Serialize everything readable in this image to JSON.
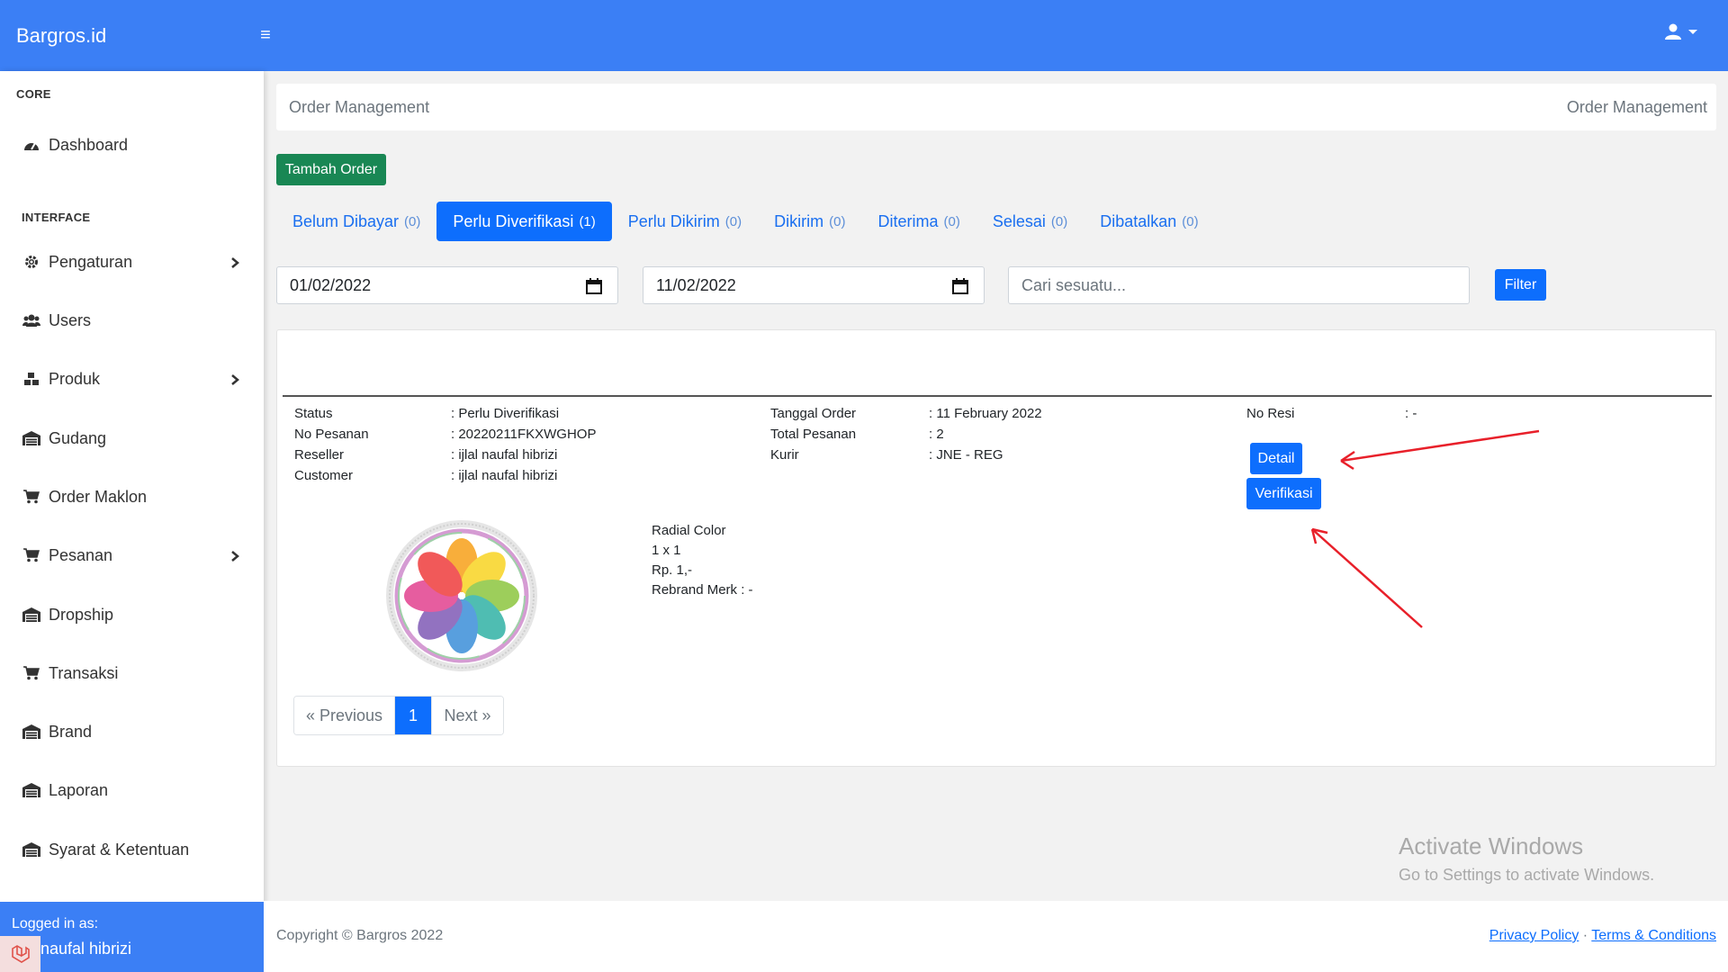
{
  "app": {
    "brand": "Bargros.id",
    "menu_icon": "hamburger-icon",
    "user_icon": "user-icon"
  },
  "sidebar": {
    "heading_core": "CORE",
    "heading_interface": "INTERFACE",
    "items": [
      {
        "label": "Dashboard",
        "icon": "tachometer-icon"
      },
      {
        "label": "Pengaturan",
        "icon": "gear-icon",
        "has_submenu": true
      },
      {
        "label": "Users",
        "icon": "users-icon"
      },
      {
        "label": "Produk",
        "icon": "boxes-icon",
        "has_submenu": true
      },
      {
        "label": "Gudang",
        "icon": "warehouse-icon"
      },
      {
        "label": "Order Maklon",
        "icon": "cart-icon"
      },
      {
        "label": "Pesanan",
        "icon": "cart-icon",
        "has_submenu": true
      },
      {
        "label": "Dropship",
        "icon": "warehouse-icon"
      },
      {
        "label": "Transaksi",
        "icon": "cart-icon"
      },
      {
        "label": "Brand",
        "icon": "warehouse-icon"
      },
      {
        "label": "Laporan",
        "icon": "warehouse-icon"
      },
      {
        "label": "Syarat & Ketentuan",
        "icon": "warehouse-icon"
      }
    ],
    "footer": {
      "label": "Logged in as:",
      "user": "naufal hibrizi"
    }
  },
  "header": {
    "title": "Order Management",
    "breadcrumb": "Order Management"
  },
  "actions": {
    "add_order": "Tambah Order"
  },
  "tabs": [
    {
      "label": "Belum Dibayar",
      "count": "(0)"
    },
    {
      "label": "Perlu Diverifikasi",
      "count": "(1)",
      "active": true
    },
    {
      "label": "Perlu Dikirim",
      "count": "(0)"
    },
    {
      "label": "Dikirim",
      "count": "(0)"
    },
    {
      "label": "Diterima",
      "count": "(0)"
    },
    {
      "label": "Selesai",
      "count": "(0)"
    },
    {
      "label": "Dibatalkan",
      "count": "(0)"
    }
  ],
  "filters": {
    "date_from": "01/02/2022",
    "date_to": "11/02/2022",
    "search_placeholder": "Cari sesuatu...",
    "filter_button": "Filter"
  },
  "order": {
    "status_label": "Status",
    "status_value": ": Perlu Diverifikasi",
    "no_pesanan_label": "No Pesanan",
    "no_pesanan_value": ": 20220211FKXWGHOP",
    "reseller_label": "Reseller",
    "reseller_value": ": ijlal naufal hibrizi",
    "customer_label": "Customer",
    "customer_value": ": ijlal naufal hibrizi",
    "tanggal_label": "Tanggal Order",
    "tanggal_value": ": 11 February 2022",
    "total_label": "Total Pesanan",
    "total_value": ": 2",
    "kurir_label": "Kurir",
    "kurir_value": ": JNE - REG",
    "resi_label": "No Resi",
    "resi_value": ": -",
    "detail_button": "Detail",
    "verify_button": "Verifikasi",
    "product": {
      "name": "Radial Color",
      "qty": "1 x 1",
      "price": "Rp. 1,-",
      "rebrand": "Rebrand Merk : -"
    }
  },
  "pagination": {
    "previous": "« Previous",
    "current": "1",
    "next": "Next »"
  },
  "watermark": {
    "line1": "Activate Windows",
    "line2": "Go to Settings to activate Windows."
  },
  "footer": {
    "copyright": "Copyright © Bargros 2022",
    "privacy": "Privacy Policy",
    "separator": "·",
    "terms": "Terms & Conditions"
  },
  "colors": {
    "primary": "#0d6efd",
    "topbar": "#3b7ff5",
    "success": "#198754",
    "annotation": "#e8202a"
  }
}
